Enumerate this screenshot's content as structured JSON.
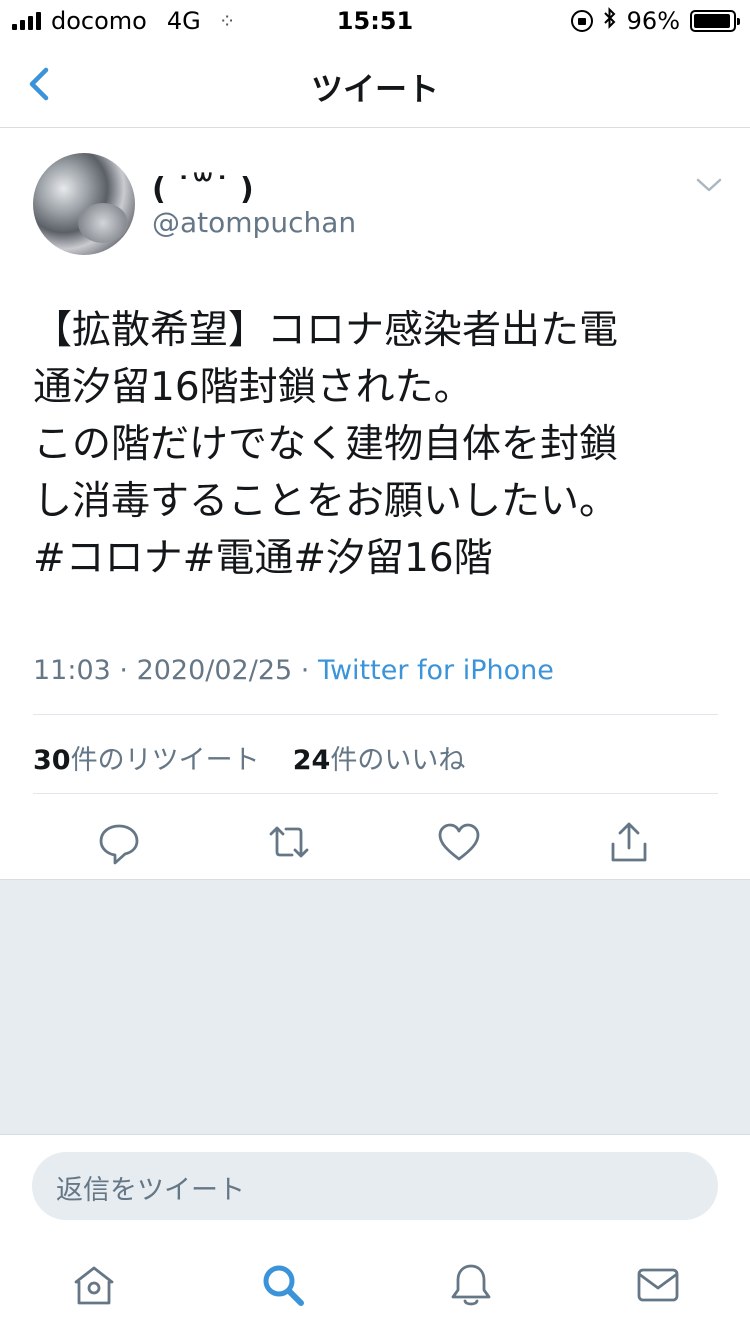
{
  "status_bar": {
    "carrier": "docomo",
    "network": "4G",
    "spinner": "⁘",
    "time": "15:51",
    "battery_percent": "96%",
    "battery_level": 0.96
  },
  "nav": {
    "title": "ツイート",
    "back_icon": "chevron-left-icon"
  },
  "tweet": {
    "display_name": "( ˙꒳˙ )",
    "handle": "@atompuchan",
    "lines": [
      "【拡散希望】コロナ感染者出た電",
      "通汐留16階封鎖された。",
      "この階だけでなく建物自体を封鎖",
      "し消毒することをお願いしたい。",
      "#コロナ#電通#汐留16階"
    ],
    "time": "11:03",
    "date": "2020/02/25",
    "separator": " · ",
    "source": "Twitter for iPhone",
    "retweet_count": "30",
    "retweet_label": "件のリツイート",
    "like_count": "24",
    "like_label": "件のいいね"
  },
  "actions": [
    "reply-icon",
    "retweet-icon",
    "like-icon",
    "share-icon"
  ],
  "reply": {
    "placeholder": "返信をツイート"
  },
  "tabbar": [
    "home-icon",
    "search-icon",
    "notifications-icon",
    "messages-icon"
  ],
  "colors": {
    "accent": "#3b94d9",
    "secondary_text": "#657786",
    "background_gray": "#e6ecf0",
    "divider": "#e1e8ed"
  }
}
